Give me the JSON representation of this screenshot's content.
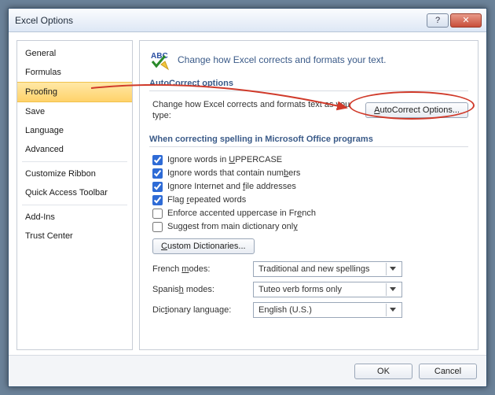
{
  "window": {
    "title": "Excel Options"
  },
  "sidebar": {
    "items": [
      {
        "label": "General"
      },
      {
        "label": "Formulas"
      },
      {
        "label": "Proofing",
        "selected": true
      },
      {
        "label": "Save"
      },
      {
        "label": "Language"
      },
      {
        "label": "Advanced"
      },
      {
        "label": "Customize Ribbon"
      },
      {
        "label": "Quick Access Toolbar"
      },
      {
        "label": "Add-Ins"
      },
      {
        "label": "Trust Center"
      }
    ]
  },
  "header": {
    "text": "Change how Excel corrects and formats your text."
  },
  "autocorrect": {
    "section_title": "AutoCorrect options",
    "desc": "Change how Excel corrects and formats text as you type:",
    "button_pre": "A",
    "button_post": "utoCorrect Options..."
  },
  "spelling": {
    "section_title": "When correcting spelling in Microsoft Office programs",
    "opts": [
      {
        "checked": true,
        "pre": "Ignore words in ",
        "u": "U",
        "post": "PPERCASE"
      },
      {
        "checked": true,
        "pre": "Ignore words that contain num",
        "u": "b",
        "post": "ers"
      },
      {
        "checked": true,
        "pre": "Ignore Internet and ",
        "u": "f",
        "post": "ile addresses"
      },
      {
        "checked": true,
        "pre": "Flag ",
        "u": "r",
        "post": "epeated words"
      },
      {
        "checked": false,
        "pre": "Enforce accented uppercase in Fr",
        "u": "e",
        "post": "nch"
      },
      {
        "checked": false,
        "pre": "Suggest from main dictionary onl",
        "u": "y",
        "post": ""
      }
    ],
    "custom_dict_pre": "C",
    "custom_dict_post": "ustom Dictionaries...",
    "french_u": "m",
    "french_pre": "French ",
    "french_post": "odes:",
    "french_value": "Traditional and new spellings",
    "spanish_u": "h",
    "spanish_pre": "Spanis",
    "spanish_post": " modes:",
    "spanish_value": "Tuteo verb forms only",
    "dict_lang_u": "t",
    "dict_lang_pre": "Dic",
    "dict_lang_post": "ionary language:",
    "dict_lang_value": "English (U.S.)"
  },
  "footer": {
    "ok": "OK",
    "cancel": "Cancel"
  }
}
